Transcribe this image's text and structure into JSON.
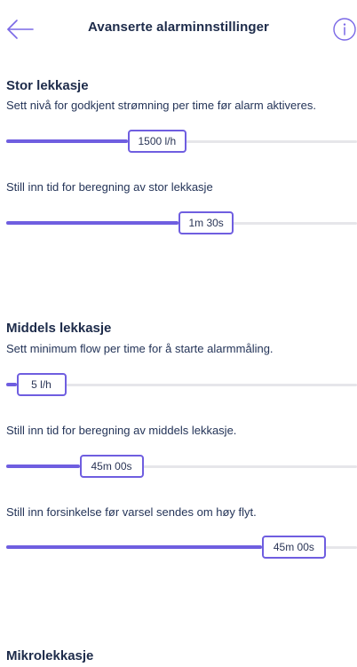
{
  "header": {
    "title": "Avanserte alarminnstillinger",
    "back_icon": "arrow-left-icon",
    "info_icon": "info-icon"
  },
  "accent_color": "#6f5ee0",
  "sections": {
    "stor": {
      "title": "Stor lekkasje",
      "description": "Sett nivå for godkjent strømning per time før alarm aktiveres.",
      "flow_value": "1500 l/h",
      "flow_fraction": 0.43,
      "time_label": "Still inn tid for beregning av stor lekkasje",
      "time_value": "1m 30s",
      "time_fraction": 0.57
    },
    "middels": {
      "title": "Middels lekkasje",
      "description": "Sett minimum flow per time for å starte alarmmåling.",
      "flow_value": "5 l/h",
      "flow_fraction": 0.1,
      "time_label": "Still inn tid for beregning av middels lekkasje.",
      "time_value": "45m 00s",
      "time_fraction": 0.3,
      "delay_label": "Still inn forsinkelse før varsel sendes om høy flyt.",
      "delay_value": "45m 00s",
      "delay_fraction": 0.82
    },
    "mikro": {
      "title": "Mikrolekkasje"
    }
  }
}
